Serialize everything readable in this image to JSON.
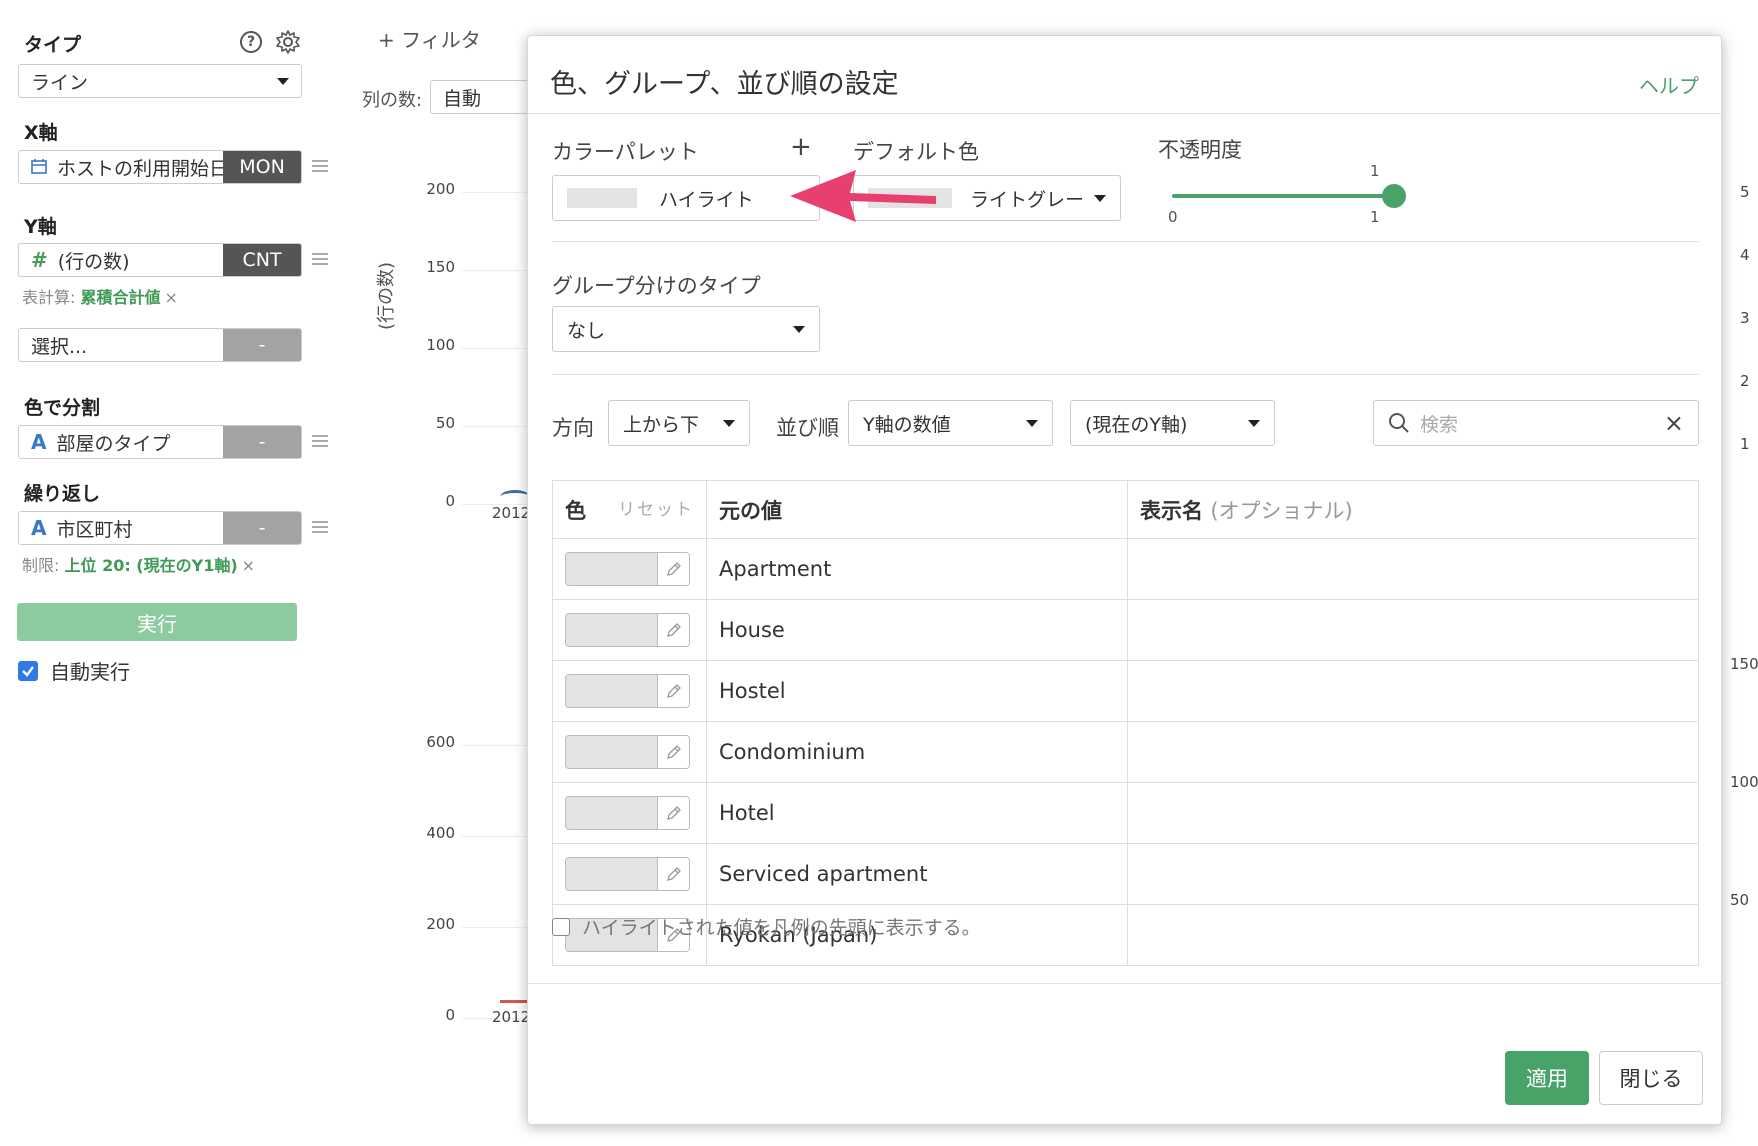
{
  "sidebar": {
    "type_label": "タイプ",
    "type_value": "ライン",
    "x_label": "X軸",
    "x_field": "ホストの利用開始日",
    "x_tag": "MON",
    "y_label": "Y軸",
    "y_field_icon": "#",
    "y_field": "(行の数)",
    "y_tag": "CNT",
    "table_calc_prefix": "表計算:",
    "table_calc_value": "累積合計値",
    "table_calc_remove": "×",
    "select_placeholder": "選択...",
    "select_tag": "-",
    "color_split_label": "色で分割",
    "color_field_icon": "A",
    "color_field": "部屋のタイプ",
    "color_tag": "-",
    "repeat_label": "繰り返し",
    "repeat_field_icon": "A",
    "repeat_field": "市区町村",
    "repeat_tag": "-",
    "limit_prefix": "制限:",
    "limit_value": "上位 20: (現在のY1軸)",
    "limit_remove": "×",
    "run_button": "実行",
    "auto_run_label": "自動実行",
    "auto_run_checked": true
  },
  "chart_area": {
    "filter_button": "+ フィルタ",
    "columns_label": "列の数:",
    "columns_value": "自動",
    "y_axis_label": "(行の数)",
    "top_ticks": [
      "200",
      "150",
      "100",
      "50",
      "0"
    ],
    "top_xtick": "2012",
    "bottom_ticks": [
      "600",
      "400",
      "200",
      "0"
    ],
    "bottom_xtick": "2012",
    "right_ticks_top": [
      "5",
      "4",
      "3",
      "2",
      "1"
    ],
    "right_ticks_bottom": [
      "150",
      "100",
      "50"
    ]
  },
  "modal": {
    "title": "色、グループ、並び順の設定",
    "help_link": "ヘルプ",
    "palette_label": "カラーパレット",
    "palette_add": "+",
    "palette_value": "ハイライト",
    "default_color_label": "デフォルト色",
    "default_color_value": "ライトグレー",
    "opacity_label": "不透明度",
    "opacity_value": 1,
    "opacity_min": "0",
    "opacity_max": "1",
    "opacity_current": "1",
    "group_type_label": "グループ分けのタイプ",
    "group_type_value": "なし",
    "direction_label": "方向",
    "direction_value": "上から下",
    "sort_label": "並び順",
    "sort_value": "Y軸の数値",
    "sort_target_value": "(現在のY軸)",
    "search_placeholder": "検索",
    "table": {
      "col_color": "色",
      "col_reset": "リセット",
      "col_original": "元の値",
      "col_display": "表示名",
      "col_display_optional": "(オプショナル)",
      "rows": [
        {
          "value": "Apartment",
          "display": ""
        },
        {
          "value": "House",
          "display": ""
        },
        {
          "value": "Hostel",
          "display": ""
        },
        {
          "value": "Condominium",
          "display": ""
        },
        {
          "value": "Hotel",
          "display": ""
        },
        {
          "value": "Serviced apartment",
          "display": ""
        },
        {
          "value": "Ryokan (Japan)",
          "display": ""
        }
      ]
    },
    "highlight_first_label": "ハイライトされた値を凡例の先頭に表示する。",
    "apply_button": "適用",
    "close_button": "閉じる"
  },
  "colors": {
    "accent_green": "#48a368",
    "run_button": "#8ccaa0",
    "arrow": "#e8406e",
    "swatch_gray": "#e3e3e3"
  }
}
